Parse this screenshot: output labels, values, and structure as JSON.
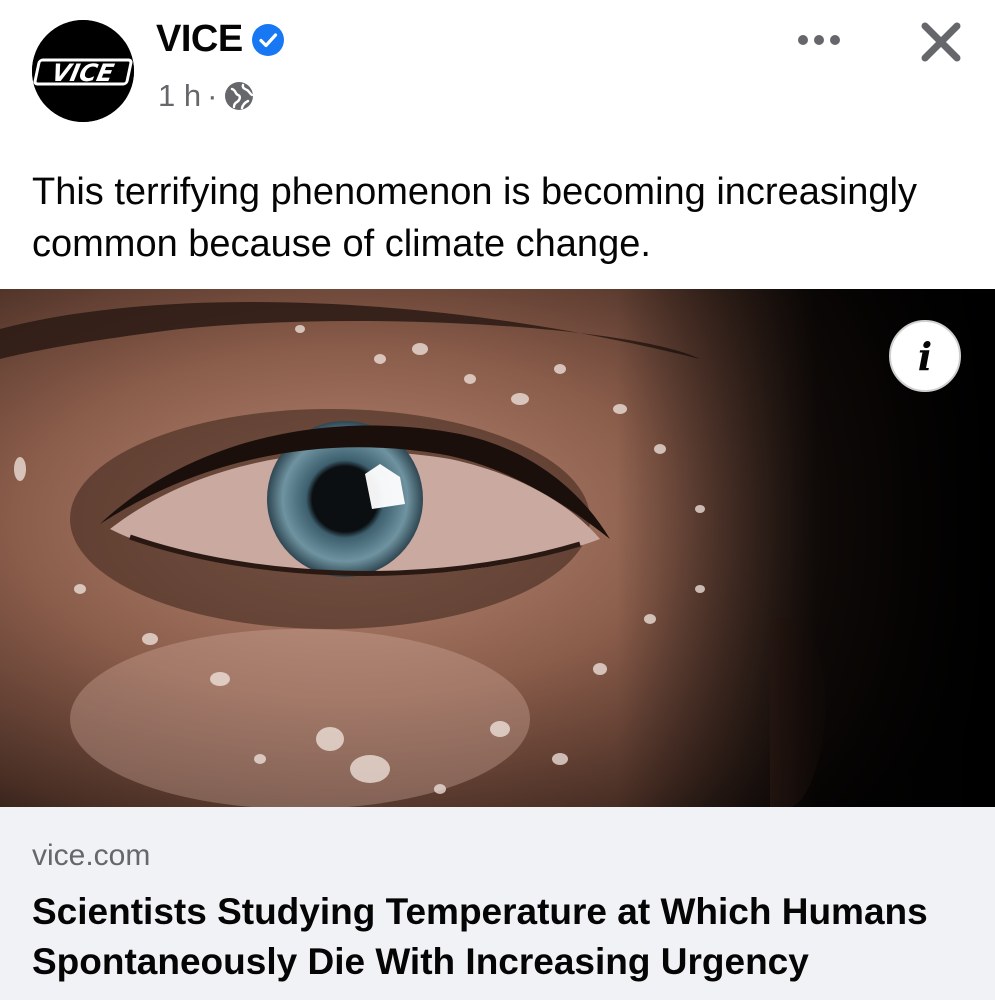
{
  "post": {
    "page_name": "VICE",
    "avatar_text": "VICE",
    "time": "1 h",
    "separator": "·",
    "caption": "This terrifying phenomenon is becoming increasingly common because of climate change."
  },
  "link_preview": {
    "domain": "vice.com",
    "title": "Scientists Studying Temperature at Which Humans Spontaneously Die With Increasing Urgency",
    "info_icon_label": "i"
  },
  "icons": {
    "verified": "verified-badge-icon",
    "privacy": "globe-icon",
    "more": "more-options-icon",
    "close": "close-icon",
    "info": "info-icon"
  },
  "colors": {
    "verified_blue": "#1877f2",
    "secondary_text": "#65676b",
    "card_background": "#f0f2f5"
  }
}
